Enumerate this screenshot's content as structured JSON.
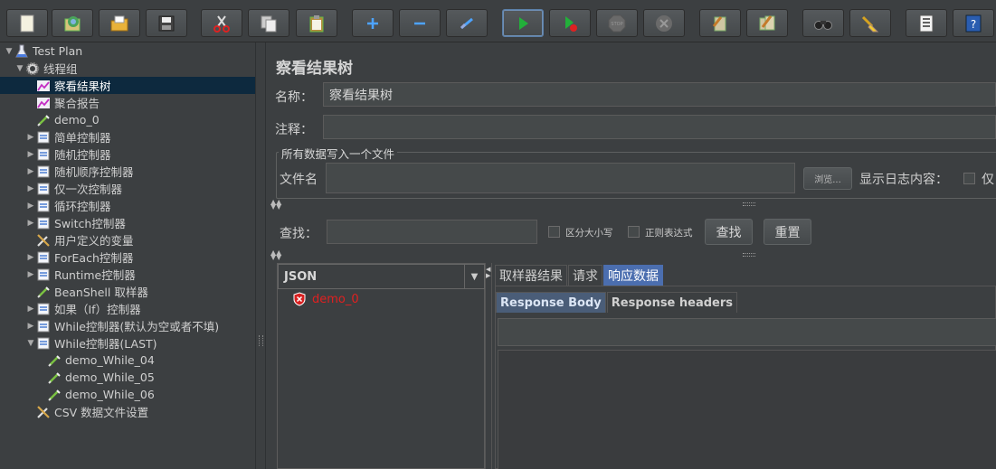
{
  "toolbar": {
    "buttons": [
      {
        "name": "new-icon"
      },
      {
        "name": "templates-icon"
      },
      {
        "name": "open-icon"
      },
      {
        "name": "save-icon"
      },
      {
        "name": "cut-icon"
      },
      {
        "name": "copy-icon"
      },
      {
        "name": "paste-icon"
      },
      {
        "name": "expand-icon"
      },
      {
        "name": "collapse-icon"
      },
      {
        "name": "toggle-icon"
      },
      {
        "name": "start-icon"
      },
      {
        "name": "start-no-pauses-icon"
      },
      {
        "name": "stop-icon"
      },
      {
        "name": "shutdown-icon"
      },
      {
        "name": "clear-icon"
      },
      {
        "name": "clear-all-icon"
      },
      {
        "name": "search-icon"
      },
      {
        "name": "reset-search-icon"
      },
      {
        "name": "function-helper-icon"
      },
      {
        "name": "help-icon"
      }
    ],
    "stop_label": "STOP"
  },
  "tree": {
    "items": [
      {
        "label": "Test Plan",
        "level": 0,
        "toggle": "▼",
        "icon": "flask"
      },
      {
        "label": "线程组",
        "level": 1,
        "toggle": "▼",
        "icon": "gear"
      },
      {
        "label": "察看结果树",
        "level": 2,
        "toggle": "",
        "icon": "chart",
        "selected": true
      },
      {
        "label": "聚合报告",
        "level": 2,
        "toggle": "",
        "icon": "chart"
      },
      {
        "label": "demo_0",
        "level": 2,
        "toggle": "",
        "icon": "pipette"
      },
      {
        "label": "简单控制器",
        "level": 2,
        "toggle": "▶",
        "icon": "controller"
      },
      {
        "label": "随机控制器",
        "level": 2,
        "toggle": "▶",
        "icon": "controller"
      },
      {
        "label": "随机顺序控制器",
        "level": 2,
        "toggle": "▶",
        "icon": "controller"
      },
      {
        "label": "仅一次控制器",
        "level": 2,
        "toggle": "▶",
        "icon": "controller"
      },
      {
        "label": "循环控制器",
        "level": 2,
        "toggle": "▶",
        "icon": "controller"
      },
      {
        "label": "Switch控制器",
        "level": 2,
        "toggle": "▶",
        "icon": "controller"
      },
      {
        "label": "用户定义的变量",
        "level": 2,
        "toggle": "",
        "icon": "wrench"
      },
      {
        "label": "ForEach控制器",
        "level": 2,
        "toggle": "▶",
        "icon": "controller"
      },
      {
        "label": "Runtime控制器",
        "level": 2,
        "toggle": "▶",
        "icon": "controller"
      },
      {
        "label": "BeanShell 取样器",
        "level": 2,
        "toggle": "",
        "icon": "pipette"
      },
      {
        "label": "如果（If）控制器",
        "level": 2,
        "toggle": "▶",
        "icon": "controller"
      },
      {
        "label": "While控制器(默认为空或者不填)",
        "level": 2,
        "toggle": "▶",
        "icon": "controller"
      },
      {
        "label": "While控制器(LAST)",
        "level": 2,
        "toggle": "▼",
        "icon": "controller"
      },
      {
        "label": "demo_While_04",
        "level": 3,
        "toggle": "",
        "icon": "pipette"
      },
      {
        "label": "demo_While_05",
        "level": 3,
        "toggle": "",
        "icon": "pipette"
      },
      {
        "label": "demo_While_06",
        "level": 3,
        "toggle": "",
        "icon": "pipette"
      },
      {
        "label": "CSV 数据文件设置",
        "level": 2,
        "toggle": "",
        "icon": "wrench"
      }
    ]
  },
  "panel": {
    "title": "察看结果树",
    "name_label": "名称：",
    "name_value": "察看结果树",
    "comment_label": "注释：",
    "comment_value": "",
    "file_group_title": "所有数据写入一个文件",
    "filename_label": "文件名",
    "filename_value": "",
    "browse_label": "浏览...",
    "log_label": "显示日志内容：",
    "only_label": "仅",
    "search_label": "查找：",
    "search_value": "",
    "case_label": "区分大小写",
    "regex_label": "正则表达式",
    "find_button": "查找",
    "reset_button": "重置",
    "renderer": "JSON",
    "results": [
      {
        "label": "demo_0",
        "status": "error"
      }
    ],
    "tabs": [
      "取样器结果",
      "请求",
      "响应数据"
    ],
    "active_tab": 2,
    "subtabs": [
      "Response Body",
      "Response headers"
    ],
    "active_subtab": 0
  },
  "colors": {
    "background": "#3c3f41",
    "selection": "#0d293e",
    "error_text": "#e02020",
    "active_tab": "#4b6eaf"
  }
}
